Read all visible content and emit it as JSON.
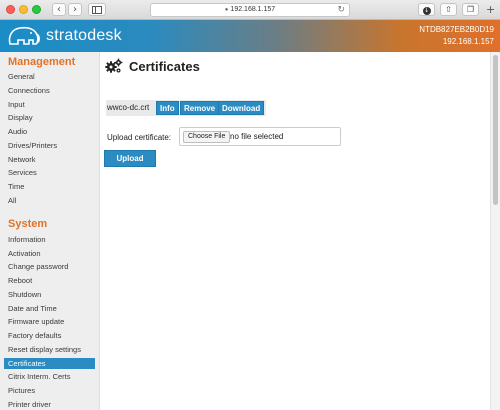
{
  "browser": {
    "address": "192.168.1.157",
    "colors": {
      "close": "#ff5f57",
      "minimize": "#febc2e",
      "maximize": "#28c840"
    },
    "icons": [
      "back-icon",
      "forward-icon",
      "sidebar-icon",
      "lock-icon",
      "reload-icon",
      "download-icon",
      "share-icon",
      "tabs-icon",
      "new-tab-icon"
    ]
  },
  "header": {
    "brand": "stratodesk",
    "device_id": "NTDB827EB2B0D19",
    "device_ip": "192.168.1.157",
    "colors": {
      "left": "#1b8cc6",
      "right": "#e0702a"
    }
  },
  "sidebar": {
    "management": {
      "title": "Management",
      "items": [
        "General",
        "Connections",
        "Input",
        "Display",
        "Audio",
        "Drives/Printers",
        "Network",
        "Services",
        "Time",
        "All"
      ]
    },
    "system": {
      "title": "System",
      "items": [
        "Information",
        "Activation",
        "Change password",
        "Reboot",
        "Shutdown",
        "Date and Time",
        "Firmware update",
        "Factory defaults",
        "Reset display settings",
        "Certificates",
        "Citrix Interm. Certs",
        "Pictures",
        "Printer driver management"
      ]
    },
    "active_item": "Certificates",
    "colors": {
      "section_title": "#e07328",
      "active_bg": "#2b8bc3"
    }
  },
  "main": {
    "title": "Certificates",
    "certificate": {
      "name": "wwco-dc.crt",
      "info_label": "Info",
      "remove_label": "Remove",
      "download_label": "Download"
    },
    "upload": {
      "label": "Upload certificate:",
      "choose_label": "Choose File",
      "status": "no file selected",
      "button_label": "Upload"
    },
    "colors": {
      "button": "#2b8bc3"
    }
  }
}
